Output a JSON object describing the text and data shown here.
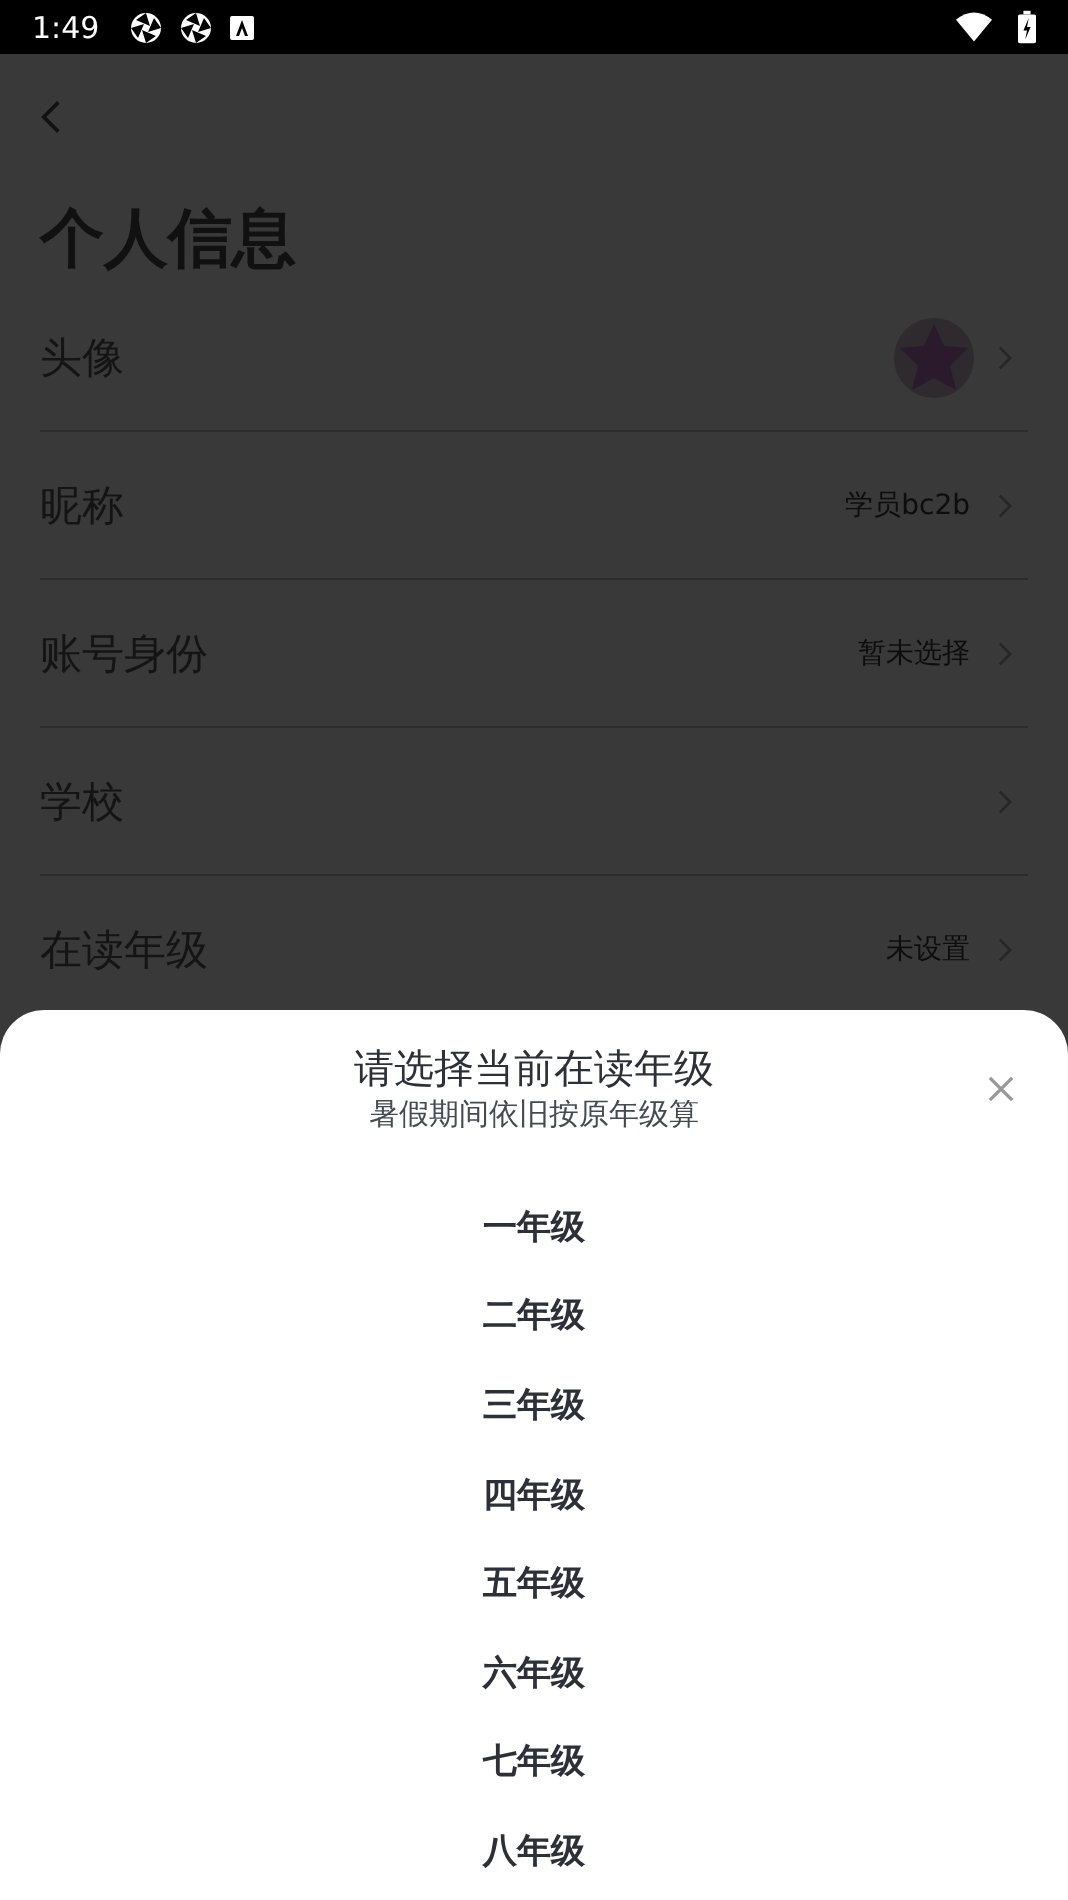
{
  "status_bar": {
    "time": "1:49"
  },
  "page": {
    "title": "个人信息",
    "rows": [
      {
        "kind": "avatar",
        "label": "头像"
      },
      {
        "kind": "text",
        "label": "昵称",
        "value": "学员bc2b"
      },
      {
        "kind": "text",
        "label": "账号身份",
        "value": "暂未选择"
      },
      {
        "kind": "text",
        "label": "学校"
      },
      {
        "kind": "text",
        "label": "在读年级",
        "value": "未设置"
      }
    ]
  },
  "sheet": {
    "title": "请选择当前在读年级",
    "subtitle": "暑假期间依旧按原年级算",
    "options": [
      "一年级",
      "二年级",
      "三年级",
      "四年级",
      "五年级",
      "六年级",
      "七年级",
      "八年级"
    ]
  }
}
